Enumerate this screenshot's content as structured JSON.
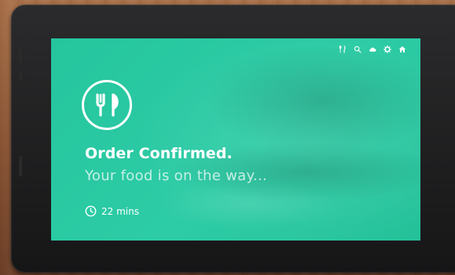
{
  "screen": {
    "background_color": "#27c6a0",
    "text_color": "#ffffff"
  },
  "status_bar": {
    "icons": [
      "fork-knife-icon",
      "search-icon",
      "cloud-icon",
      "gear-icon",
      "home-icon"
    ]
  },
  "order": {
    "logo_icon": "fork-knife-badge-icon",
    "title": "Order Confirmed.",
    "message": "Your food is on the way...",
    "eta_icon": "clock-icon",
    "eta": "22 mins"
  }
}
